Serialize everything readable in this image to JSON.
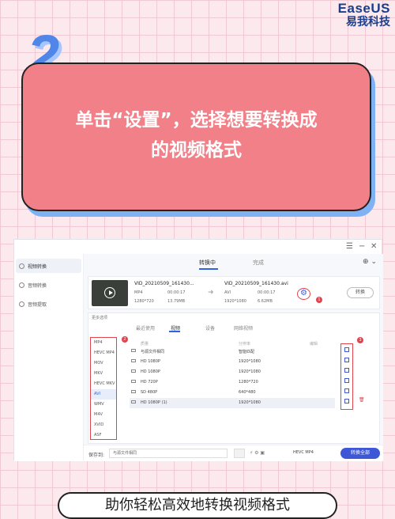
{
  "brand": {
    "name_en": "EaseUS",
    "name_cn": "易我科技"
  },
  "step": {
    "number": "2"
  },
  "banner": {
    "line1": "单击“设置”，选择想要转换成",
    "line2": "的视频格式"
  },
  "sidebar": {
    "items": [
      {
        "label": "视频转换",
        "icon": "video-icon"
      },
      {
        "label": "音频转换",
        "icon": "audio-icon"
      },
      {
        "label": "音频提取",
        "icon": "extract-icon"
      }
    ]
  },
  "tabs": {
    "converting": "转换中",
    "done": "完成"
  },
  "file": {
    "src_name": "VID_20210509_161430...",
    "src_format": "MP4",
    "src_duration": "00:00:17",
    "src_resolution": "1280*720",
    "src_size": "13.79MB",
    "dst_name": "VID_20210509_161430.avi",
    "dst_format": "AVI",
    "dst_duration": "00:00:17",
    "dst_resolution": "1920*1080",
    "dst_size": "6.62MB",
    "convert_label": "转换"
  },
  "badges": {
    "b1": "1",
    "b2": "2",
    "b3": "3"
  },
  "panel": {
    "more_label": "更多选项",
    "tabs": [
      "最近使用",
      "视频",
      "设备",
      "网络视频"
    ],
    "formats": [
      "MP4",
      "HEVC MP4",
      "MOV",
      "MKV",
      "HEVC MKV",
      "AVI",
      "WMV",
      "M4V",
      "XVID",
      "ASF"
    ],
    "headers": [
      "质量",
      "分辨率",
      "编辑"
    ],
    "rows": [
      {
        "quality": "与源文件相同",
        "resolution": "智能匹配"
      },
      {
        "quality": "HD 1080P",
        "resolution": "1920*1080"
      },
      {
        "quality": "HD 1080P",
        "resolution": "1920*1080"
      },
      {
        "quality": "HD 720P",
        "resolution": "1280*720"
      },
      {
        "quality": "SD 480P",
        "resolution": "640*480"
      },
      {
        "quality": "HD 1080P (1)",
        "resolution": "1920*1080"
      }
    ]
  },
  "bottom": {
    "save_label": "保存到:",
    "save_path": "与源文件相同",
    "hevc_label": "HEVC MP4",
    "convert_all": "转换全部"
  },
  "footer": {
    "text": "助你轻松高效地转换视频格式"
  }
}
